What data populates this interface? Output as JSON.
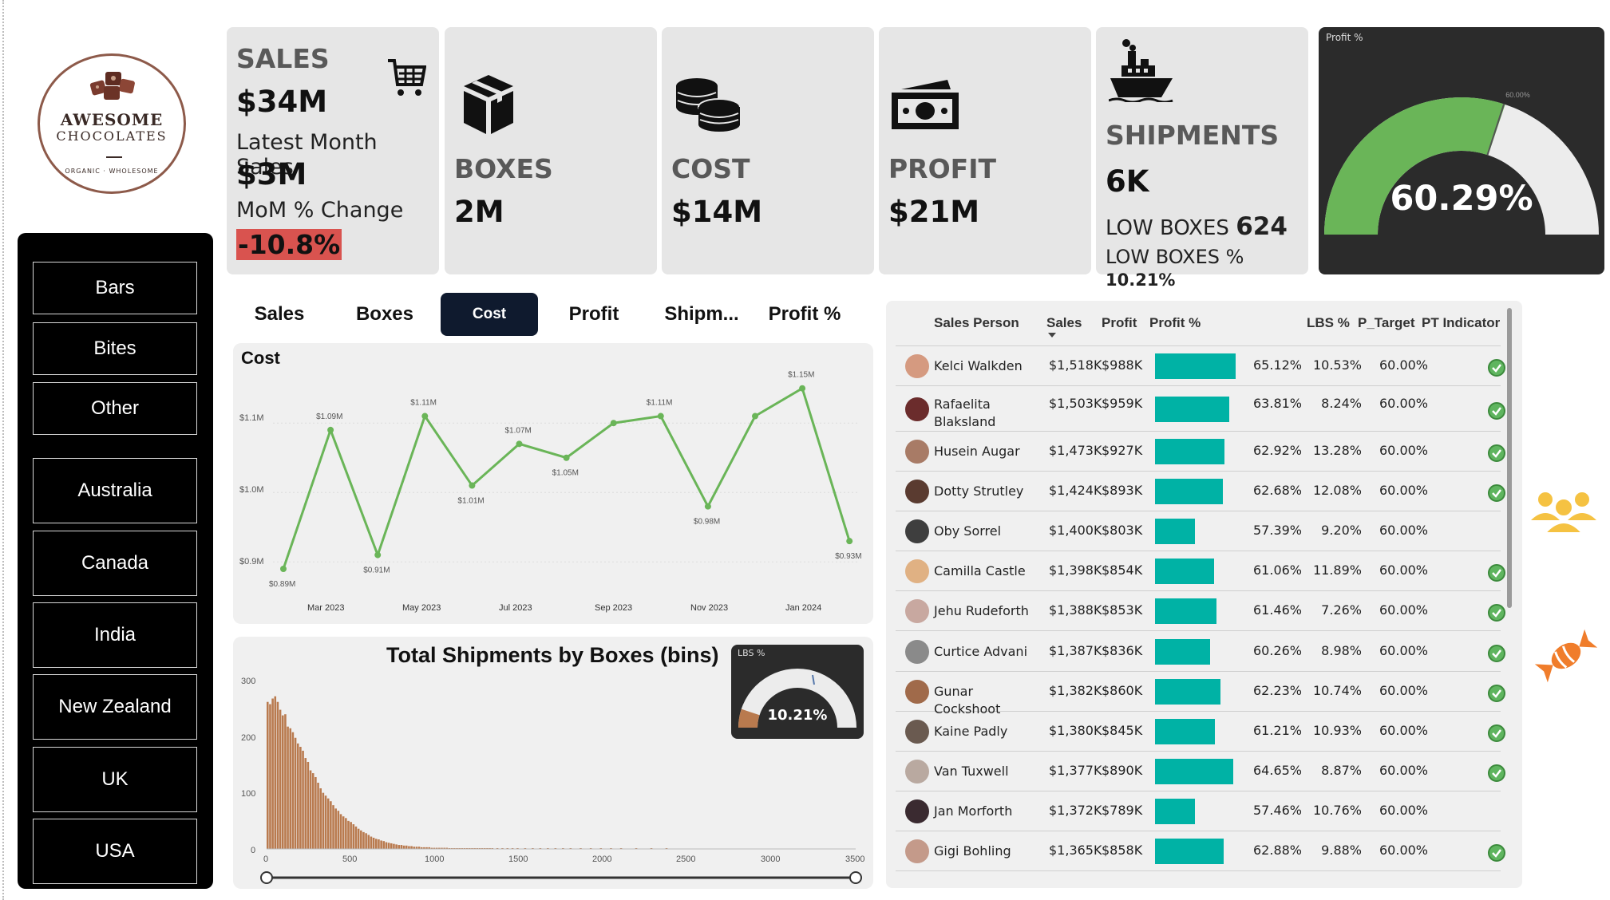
{
  "logo": {
    "line1": "AWESOME",
    "line2": "CHOCOLATES",
    "line3": "ORGANIC · WHOLESOME"
  },
  "slicers": {
    "products": [
      "Bars",
      "Bites",
      "Other"
    ],
    "countries": [
      "Australia",
      "Canada",
      "India",
      "New Zealand",
      "UK",
      "USA"
    ]
  },
  "kpi": {
    "sales": {
      "title": "SALES",
      "value": "$34M",
      "latest_label": "Latest Month Sales",
      "latest_value": "$3M",
      "mom_label": "MoM % Change",
      "mom_value": "-10.8%"
    },
    "boxes": {
      "title": "BOXES",
      "value": "2M"
    },
    "cost": {
      "title": "COST",
      "value": "$14M"
    },
    "profit": {
      "title": "PROFIT",
      "value": "$21M"
    },
    "shipments": {
      "title": "SHIPMENTS",
      "value": "6K",
      "low_boxes_label": "LOW BOXES",
      "low_boxes_value": "624",
      "low_boxes_pct_label": "LOW BOXES %",
      "low_boxes_pct_value": "10.21%"
    }
  },
  "profit_gauge": {
    "title": "Profit %",
    "value_label": "60.29%",
    "value": 60.29,
    "target": 60.0,
    "target_label": "60.00%",
    "fill_color": "#6ab558"
  },
  "tabs": [
    {
      "label": "Sales",
      "active": false
    },
    {
      "label": "Boxes",
      "active": false
    },
    {
      "label": "Cost",
      "active": true
    },
    {
      "label": "Profit",
      "active": false
    },
    {
      "label": "Shipm...",
      "active": false
    },
    {
      "label": "Profit %",
      "active": false
    }
  ],
  "cost_chart": {
    "title": "Cost",
    "y_ticks": [
      "$1.1M",
      "$1.0M",
      "$0.9M"
    ],
    "x_ticks": [
      "Mar 2023",
      "May 2023",
      "Jul 2023",
      "Sep 2023",
      "Nov 2023",
      "Jan 2024"
    ]
  },
  "shipments_chart": {
    "title": "Total Shipments by Boxes (bins)",
    "y_ticks": [
      "300",
      "200",
      "100",
      "0"
    ],
    "x_ticks": [
      "0",
      "500",
      "1000",
      "1500",
      "2000",
      "2500",
      "3000",
      "3500"
    ],
    "lbs_gauge": {
      "title": "LBS %",
      "value_label": "10.21%",
      "value": 10.21
    }
  },
  "chart_data": [
    {
      "type": "line",
      "title": "Cost",
      "x": [
        "Feb 2023",
        "Mar 2023",
        "Apr 2023",
        "May 2023",
        "Jun 2023",
        "Jul 2023",
        "Aug 2023",
        "Sep 2023",
        "Oct 2023",
        "Nov 2023",
        "Dec 2023",
        "Jan 2024",
        "Feb 2024"
      ],
      "values": [
        0.89,
        1.09,
        0.91,
        1.11,
        1.01,
        1.07,
        1.05,
        1.1,
        1.11,
        0.98,
        1.11,
        1.15,
        0.93
      ],
      "data_labels": [
        "$0.89M",
        "$1.09M",
        "$0.91M",
        "$1.11M",
        "$1.01M",
        "$1.07M",
        "$1.05M",
        "",
        "$1.11M",
        "$0.98M",
        "",
        "$1.15M",
        "$0.93M"
      ],
      "ylim": [
        0.89,
        1.16
      ],
      "color": "#6ab558"
    },
    {
      "type": "bar",
      "title": "Total Shipments by Boxes (bins)",
      "bin_width": 15,
      "x_start": 0,
      "values": [
        262,
        258,
        268,
        272,
        262,
        248,
        238,
        240,
        218,
        215,
        208,
        198,
        188,
        182,
        175,
        162,
        155,
        140,
        135,
        128,
        118,
        108,
        100,
        95,
        90,
        85,
        78,
        72,
        68,
        62,
        58,
        55,
        50,
        48,
        44,
        40,
        36,
        33,
        30,
        28,
        25,
        22,
        20,
        18,
        17,
        15,
        14,
        12,
        11,
        10,
        9,
        8,
        7,
        7,
        6,
        6,
        5,
        5,
        4,
        4,
        4,
        3,
        3,
        3,
        3,
        2,
        2,
        2,
        2,
        2,
        2,
        2,
        1,
        1,
        1,
        1,
        1,
        1,
        1,
        1,
        1,
        1,
        1,
        1,
        1,
        1,
        1,
        1,
        1,
        1,
        0,
        1,
        0,
        1,
        0,
        1,
        0,
        1,
        0,
        1,
        0,
        0,
        1,
        0,
        0,
        1,
        0,
        0,
        1,
        0,
        0,
        1,
        0,
        0,
        1,
        0,
        0,
        1,
        0,
        0,
        1,
        0,
        0,
        0,
        1,
        0,
        0,
        0,
        1,
        0,
        0,
        0,
        1,
        0,
        0,
        0,
        1,
        0,
        0,
        0,
        1,
        0,
        0,
        0,
        0,
        0,
        1,
        0,
        0,
        0,
        0,
        0,
        1,
        0,
        0,
        0,
        0,
        0,
        1
      ],
      "ylim": [
        0,
        300
      ],
      "xlim": [
        0,
        3500
      ],
      "color": "#b97a4e"
    }
  ],
  "table": {
    "headers": [
      "Sales Person",
      "Sales",
      "Profit",
      "Profit %",
      "LBS %",
      "P_Target",
      "PT Indicator"
    ],
    "rows": [
      {
        "name": "Kelci Walkden",
        "sales": "$1,518K",
        "profit": "$988K",
        "profit_pct": "65.12%",
        "pct": 65.12,
        "lbs": "10.53%",
        "target": "60.00%",
        "ok": true
      },
      {
        "name": "Rafaelita Blaksland",
        "sales": "$1,503K",
        "profit": "$959K",
        "profit_pct": "63.81%",
        "pct": 63.81,
        "lbs": "8.24%",
        "target": "60.00%",
        "ok": true
      },
      {
        "name": "Husein Augar",
        "sales": "$1,473K",
        "profit": "$927K",
        "profit_pct": "62.92%",
        "pct": 62.92,
        "lbs": "13.28%",
        "target": "60.00%",
        "ok": true
      },
      {
        "name": "Dotty Strutley",
        "sales": "$1,424K",
        "profit": "$893K",
        "profit_pct": "62.68%",
        "pct": 62.68,
        "lbs": "12.08%",
        "target": "60.00%",
        "ok": true
      },
      {
        "name": "Oby Sorrel",
        "sales": "$1,400K",
        "profit": "$803K",
        "profit_pct": "57.39%",
        "pct": 57.39,
        "lbs": "9.20%",
        "target": "60.00%",
        "ok": false
      },
      {
        "name": "Camilla Castle",
        "sales": "$1,398K",
        "profit": "$854K",
        "profit_pct": "61.06%",
        "pct": 61.06,
        "lbs": "11.89%",
        "target": "60.00%",
        "ok": true
      },
      {
        "name": "Jehu Rudeforth",
        "sales": "$1,388K",
        "profit": "$853K",
        "profit_pct": "61.46%",
        "pct": 61.46,
        "lbs": "7.26%",
        "target": "60.00%",
        "ok": true
      },
      {
        "name": "Curtice Advani",
        "sales": "$1,387K",
        "profit": "$836K",
        "profit_pct": "60.26%",
        "pct": 60.26,
        "lbs": "8.98%",
        "target": "60.00%",
        "ok": true
      },
      {
        "name": "Gunar Cockshoot",
        "sales": "$1,382K",
        "profit": "$860K",
        "profit_pct": "62.23%",
        "pct": 62.23,
        "lbs": "10.74%",
        "target": "60.00%",
        "ok": true
      },
      {
        "name": "Kaine Padly",
        "sales": "$1,380K",
        "profit": "$845K",
        "profit_pct": "61.21%",
        "pct": 61.21,
        "lbs": "10.93%",
        "target": "60.00%",
        "ok": true
      },
      {
        "name": "Van Tuxwell",
        "sales": "$1,377K",
        "profit": "$890K",
        "profit_pct": "64.65%",
        "pct": 64.65,
        "lbs": "8.87%",
        "target": "60.00%",
        "ok": true
      },
      {
        "name": "Jan Morforth",
        "sales": "$1,372K",
        "profit": "$789K",
        "profit_pct": "57.46%",
        "pct": 57.46,
        "lbs": "10.76%",
        "target": "60.00%",
        "ok": false
      },
      {
        "name": "Gigi Bohling",
        "sales": "$1,365K",
        "profit": "$858K",
        "profit_pct": "62.88%",
        "pct": 62.88,
        "lbs": "9.88%",
        "target": "60.00%",
        "ok": true
      }
    ]
  },
  "colors": {
    "teal_bar": "#00b2a5",
    "negative_badge": "#d9534f",
    "people_icon": "#f5c242",
    "candy_icon": "#f07d2b"
  },
  "icons": [
    "cart-icon",
    "box-icon",
    "coins-icon",
    "cash-icon",
    "ship-icon",
    "people-icon",
    "candy-icon",
    "check-icon"
  ]
}
